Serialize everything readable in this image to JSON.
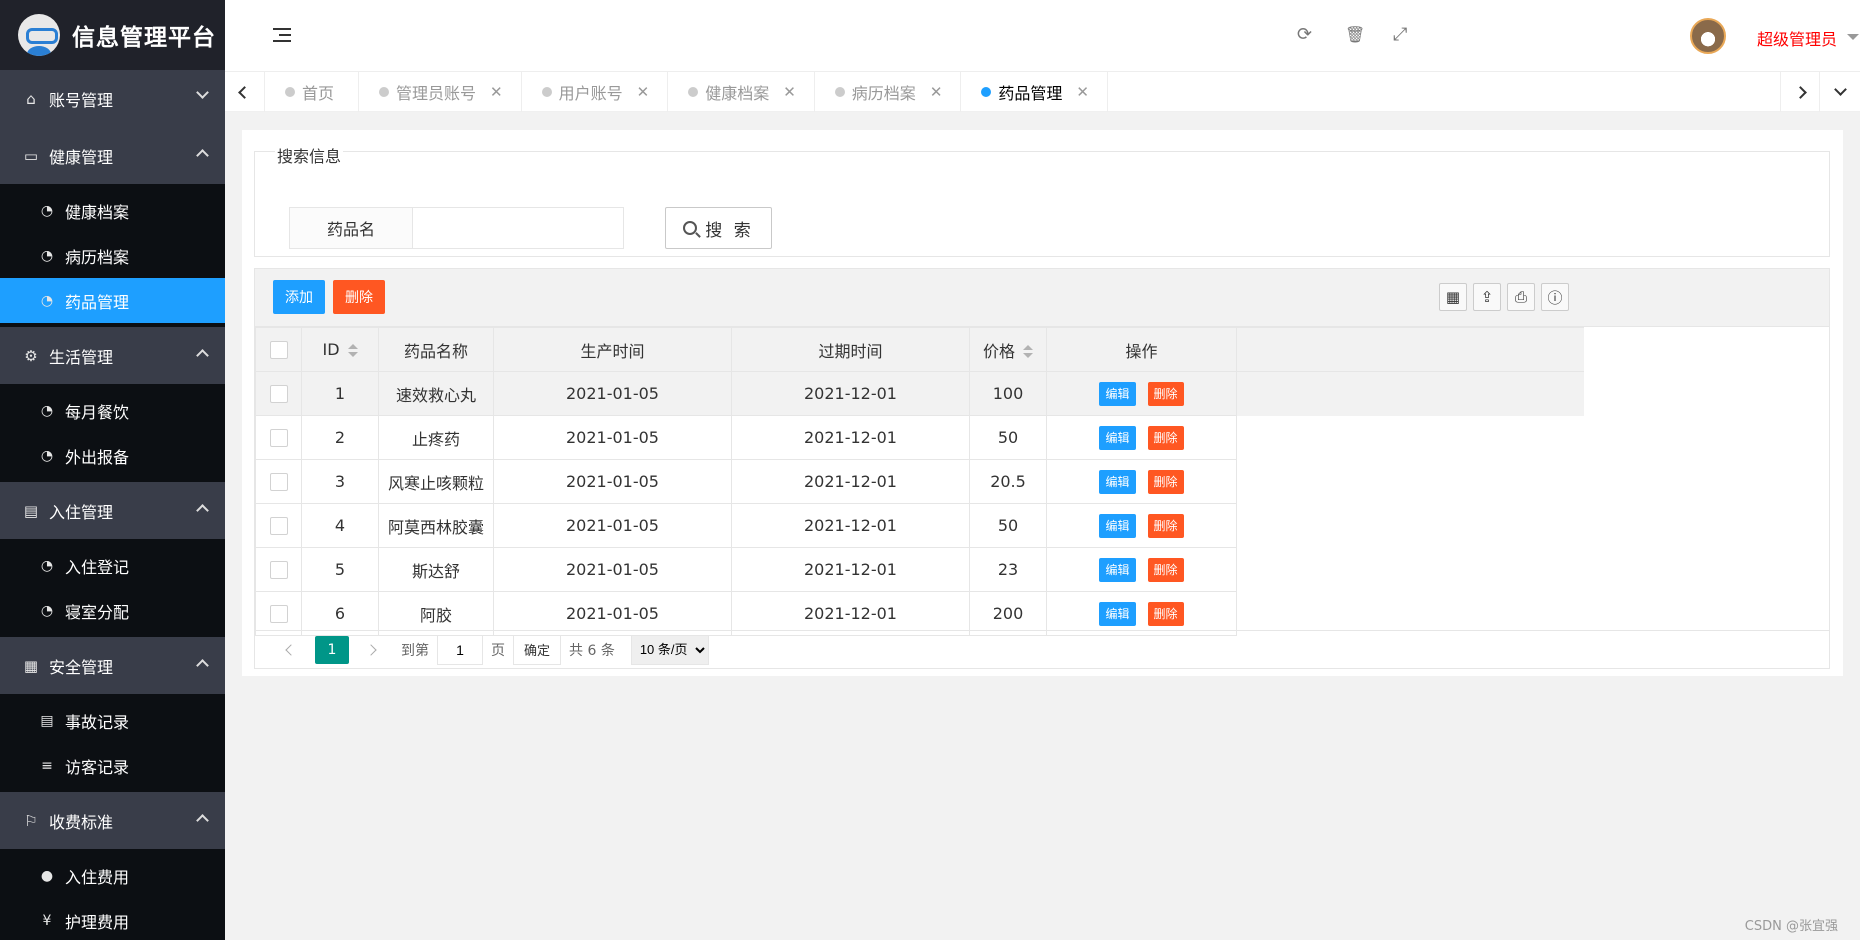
{
  "app": {
    "title": "信息管理平台"
  },
  "sidebar": {
    "groups": [
      {
        "label": "账号管理",
        "icon": "home-icon",
        "expanded": false,
        "items": []
      },
      {
        "label": "健康管理",
        "icon": "window-icon",
        "expanded": true,
        "items": [
          {
            "label": "健康档案",
            "icon": "dashboard-icon"
          },
          {
            "label": "病历档案",
            "icon": "dashboard-icon"
          },
          {
            "label": "药品管理",
            "icon": "dashboard-icon",
            "active": true
          }
        ]
      },
      {
        "label": "生活管理",
        "icon": "gears-icon",
        "expanded": true,
        "items": [
          {
            "label": "每月餐饮",
            "icon": "dashboard-icon"
          },
          {
            "label": "外出报备",
            "icon": "dashboard-icon"
          }
        ]
      },
      {
        "label": "入住管理",
        "icon": "file-icon",
        "expanded": true,
        "items": [
          {
            "label": "入住登记",
            "icon": "dashboard-icon"
          },
          {
            "label": "寝室分配",
            "icon": "dashboard-icon"
          }
        ]
      },
      {
        "label": "安全管理",
        "icon": "calendar-icon",
        "expanded": true,
        "items": [
          {
            "label": "事故记录",
            "icon": "list-alt-icon"
          },
          {
            "label": "访客记录",
            "icon": "bars-icon"
          }
        ]
      },
      {
        "label": "收费标准",
        "icon": "flag-icon",
        "expanded": true,
        "items": [
          {
            "label": "入住费用",
            "icon": "coin-icon"
          },
          {
            "label": "护理费用",
            "icon": "yen-icon"
          }
        ]
      }
    ]
  },
  "header": {
    "user_name": "超级管理员",
    "icons": [
      "refresh-icon",
      "trash-icon",
      "fullscreen-icon"
    ]
  },
  "tabs": [
    {
      "label": "首页",
      "closable": false,
      "active": false
    },
    {
      "label": "管理员账号",
      "closable": true,
      "active": false
    },
    {
      "label": "用户账号",
      "closable": true,
      "active": false
    },
    {
      "label": "健康档案",
      "closable": true,
      "active": false
    },
    {
      "label": "病历档案",
      "closable": true,
      "active": false
    },
    {
      "label": "药品管理",
      "closable": true,
      "active": true
    }
  ],
  "search": {
    "legend": "搜索信息",
    "field_label": "药品名",
    "value": "",
    "placeholder": "",
    "button_label": "搜 索"
  },
  "toolbar": {
    "add_label": "添加",
    "delete_label": "删除"
  },
  "table": {
    "columns": [
      "ID",
      "药品名称",
      "生产时间",
      "过期时间",
      "价格",
      "操作"
    ],
    "edit_label": "编辑",
    "delete_label": "删除",
    "rows": [
      {
        "id": "1",
        "name": "速效救心丸",
        "produced": "2021-01-05",
        "expires": "2021-12-01",
        "price": "100"
      },
      {
        "id": "2",
        "name": "止疼药",
        "produced": "2021-01-05",
        "expires": "2021-12-01",
        "price": "50"
      },
      {
        "id": "3",
        "name": "风寒止咳颗粒",
        "produced": "2021-01-05",
        "expires": "2021-12-01",
        "price": "20.5"
      },
      {
        "id": "4",
        "name": "阿莫西林胶囊",
        "produced": "2021-01-05",
        "expires": "2021-12-01",
        "price": "50"
      },
      {
        "id": "5",
        "name": "斯达舒",
        "produced": "2021-01-05",
        "expires": "2021-12-01",
        "price": "23"
      },
      {
        "id": "6",
        "name": "阿胶",
        "produced": "2021-01-05",
        "expires": "2021-12-01",
        "price": "200"
      }
    ]
  },
  "pager": {
    "current": "1",
    "goto_label": "到第",
    "goto_value": "1",
    "page_label": "页",
    "confirm_label": "确定",
    "total_label": "共 6 条",
    "page_size": "10 条/页"
  },
  "watermark": "CSDN @张宜强",
  "colors": {
    "sidebar": "#20222a",
    "active": "#1e9fff",
    "danger": "#ff5722",
    "pager": "#009688",
    "user": "#ff0000"
  }
}
